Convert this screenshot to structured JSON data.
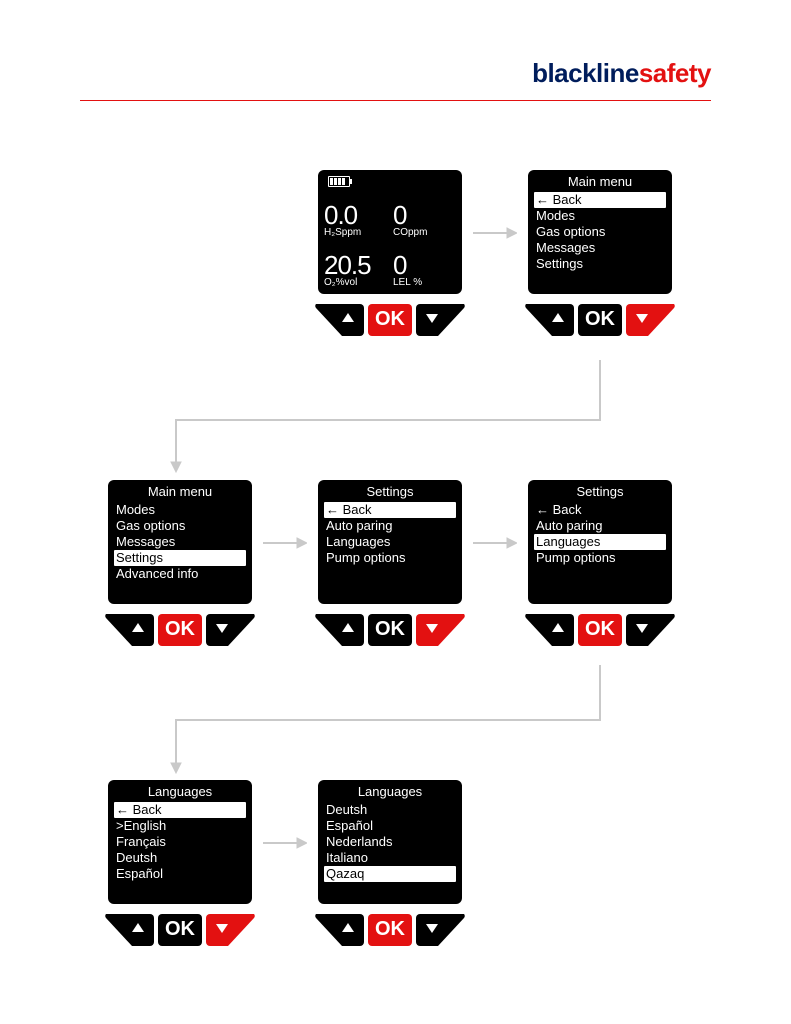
{
  "brand": {
    "part1": "blackline",
    "part2": "safety"
  },
  "sensors": {
    "cells": [
      {
        "value": "0.0",
        "label": "H₂Sppm"
      },
      {
        "value": "0",
        "label": "COppm"
      },
      {
        "value": "20.5",
        "label": "O₂%vol"
      },
      {
        "value": "0",
        "label": "LEL %"
      }
    ]
  },
  "screens": {
    "mainmenu_top": {
      "title": "Main menu",
      "items": [
        "← Back",
        "Modes",
        "Gas options",
        "Messages",
        "Settings"
      ],
      "selected": 0
    },
    "mainmenu_settings": {
      "title": "Main menu",
      "items": [
        "Modes",
        "Gas options",
        "Messages",
        "Settings",
        "Advanced info"
      ],
      "selected": 3
    },
    "settings_back": {
      "title": "Settings",
      "items": [
        "← Back",
        "Auto paring",
        "Languages",
        "Pump options"
      ],
      "selected": 0
    },
    "settings_lang": {
      "title": "Settings",
      "items": [
        "← Back",
        "Auto paring",
        "Languages",
        "Pump options"
      ],
      "selected": 2
    },
    "languages_back": {
      "title": "Languages",
      "items": [
        "← Back",
        ">English",
        "Français",
        "Deutsh",
        "Español"
      ],
      "selected": 0
    },
    "languages_qazaq": {
      "title": "Languages",
      "items": [
        "Deutsh",
        "Español",
        "Nederlands",
        "Italiano",
        "Qazaq"
      ],
      "selected": 4
    }
  },
  "keypad": {
    "ok": "OK",
    "highlight": {
      "d1": "ok",
      "d2": "down",
      "d3": "ok",
      "d4": "down",
      "d5": "ok",
      "d6": "down",
      "d7": "ok"
    }
  }
}
